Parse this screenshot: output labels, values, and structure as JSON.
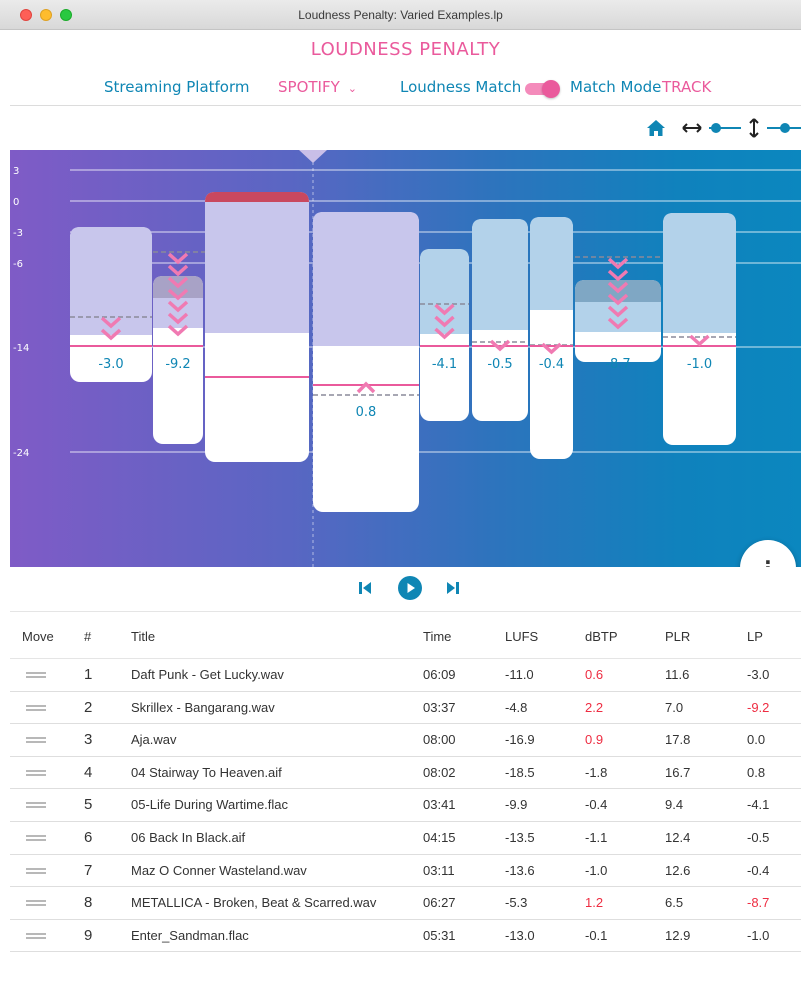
{
  "window": {
    "title": "Loudness Penalty: Varied Examples.lp"
  },
  "header": {
    "app_title": "LOUDNESS PENALTY",
    "platform_label": "Streaming Platform",
    "platform_value": "SPOTIFY",
    "loudness_match_label": "Loudness Match",
    "loudness_match_on": true,
    "match_mode_label": "Match Mode",
    "match_mode_value": "TRACK"
  },
  "icons": {
    "home": "home-icon",
    "h_zoom": "horizontal-zoom-icon",
    "v_zoom": "vertical-zoom-icon",
    "more": "more-vertical-icon",
    "prev": "skip-previous-icon",
    "play": "play-icon",
    "next": "skip-next-icon",
    "drag": "drag-handle-icon"
  },
  "colors": {
    "pink": "#ea5a9c",
    "blue": "#0f86b4",
    "red": "#ee2d42"
  },
  "chart_data": {
    "type": "bar",
    "y_ticks": [
      "3",
      "0",
      "-3",
      "-6",
      "-14",
      "-24"
    ],
    "tracks": [
      {
        "label": "-3.0",
        "penalty": -3.0,
        "lufs": -11.0,
        "dbtp": 0.6
      },
      {
        "label": "-9.2",
        "penalty": -9.2,
        "lufs": -4.8,
        "dbtp": 2.2
      },
      {
        "label": "",
        "penalty": 0.0,
        "lufs": -16.9,
        "dbtp": 0.9
      },
      {
        "label": "0.8",
        "penalty": 0.8,
        "lufs": -18.5,
        "dbtp": -1.8
      },
      {
        "label": "-4.1",
        "penalty": -4.1,
        "lufs": -9.9,
        "dbtp": -0.4
      },
      {
        "label": "-0.5",
        "penalty": -0.5,
        "lufs": -13.5,
        "dbtp": -1.1
      },
      {
        "label": "-0.4",
        "penalty": -0.4,
        "lufs": -13.6,
        "dbtp": -1.0
      },
      {
        "label": "-8.7",
        "penalty": -8.7,
        "lufs": -5.3,
        "dbtp": 1.2
      },
      {
        "label": "-1.0",
        "penalty": -1.0,
        "lufs": -13.0,
        "dbtp": -0.1
      }
    ]
  },
  "table": {
    "headers": {
      "move": "Move",
      "num": "#",
      "title": "Title",
      "time": "Time",
      "lufs": "LUFS",
      "dbtp": "dBTP",
      "plr": "PLR",
      "lp": "LP"
    },
    "rows": [
      {
        "num": "1",
        "title": "Daft Punk - Get Lucky.wav",
        "time": "06:09",
        "lufs": "-11.0",
        "dbtp": "0.6",
        "plr": "11.6",
        "lp": "-3.0",
        "dbtp_red": true,
        "lp_red": false
      },
      {
        "num": "2",
        "title": "Skrillex - Bangarang.wav",
        "time": "03:37",
        "lufs": "-4.8",
        "dbtp": "2.2",
        "plr": "7.0",
        "lp": "-9.2",
        "dbtp_red": true,
        "lp_red": true
      },
      {
        "num": "3",
        "title": "Aja.wav",
        "time": "08:00",
        "lufs": "-16.9",
        "dbtp": "0.9",
        "plr": "17.8",
        "lp": "0.0",
        "dbtp_red": true,
        "lp_red": false
      },
      {
        "num": "4",
        "title": "04 Stairway To Heaven.aif",
        "time": "08:02",
        "lufs": "-18.5",
        "dbtp": "-1.8",
        "plr": "16.7",
        "lp": "0.8",
        "dbtp_red": false,
        "lp_red": false
      },
      {
        "num": "5",
        "title": "05-Life During Wartime.flac",
        "time": "03:41",
        "lufs": "-9.9",
        "dbtp": "-0.4",
        "plr": "9.4",
        "lp": "-4.1",
        "dbtp_red": false,
        "lp_red": false
      },
      {
        "num": "6",
        "title": "06 Back In Black.aif",
        "time": "04:15",
        "lufs": "-13.5",
        "dbtp": "-1.1",
        "plr": "12.4",
        "lp": "-0.5",
        "dbtp_red": false,
        "lp_red": false
      },
      {
        "num": "7",
        "title": "Maz O Conner Wasteland.wav",
        "time": "03:11",
        "lufs": "-13.6",
        "dbtp": "-1.0",
        "plr": "12.6",
        "lp": "-0.4",
        "dbtp_red": false,
        "lp_red": false
      },
      {
        "num": "8",
        "title": "METALLICA - Broken, Beat & Scarred.wav",
        "time": "06:27",
        "lufs": "-5.3",
        "dbtp": "1.2",
        "plr": "6.5",
        "lp": "-8.7",
        "dbtp_red": true,
        "lp_red": true
      },
      {
        "num": "9",
        "title": "Enter_Sandman.flac",
        "time": "05:31",
        "lufs": "-13.0",
        "dbtp": "-0.1",
        "plr": "12.9",
        "lp": "-1.0",
        "dbtp_red": false,
        "lp_red": false
      }
    ]
  }
}
